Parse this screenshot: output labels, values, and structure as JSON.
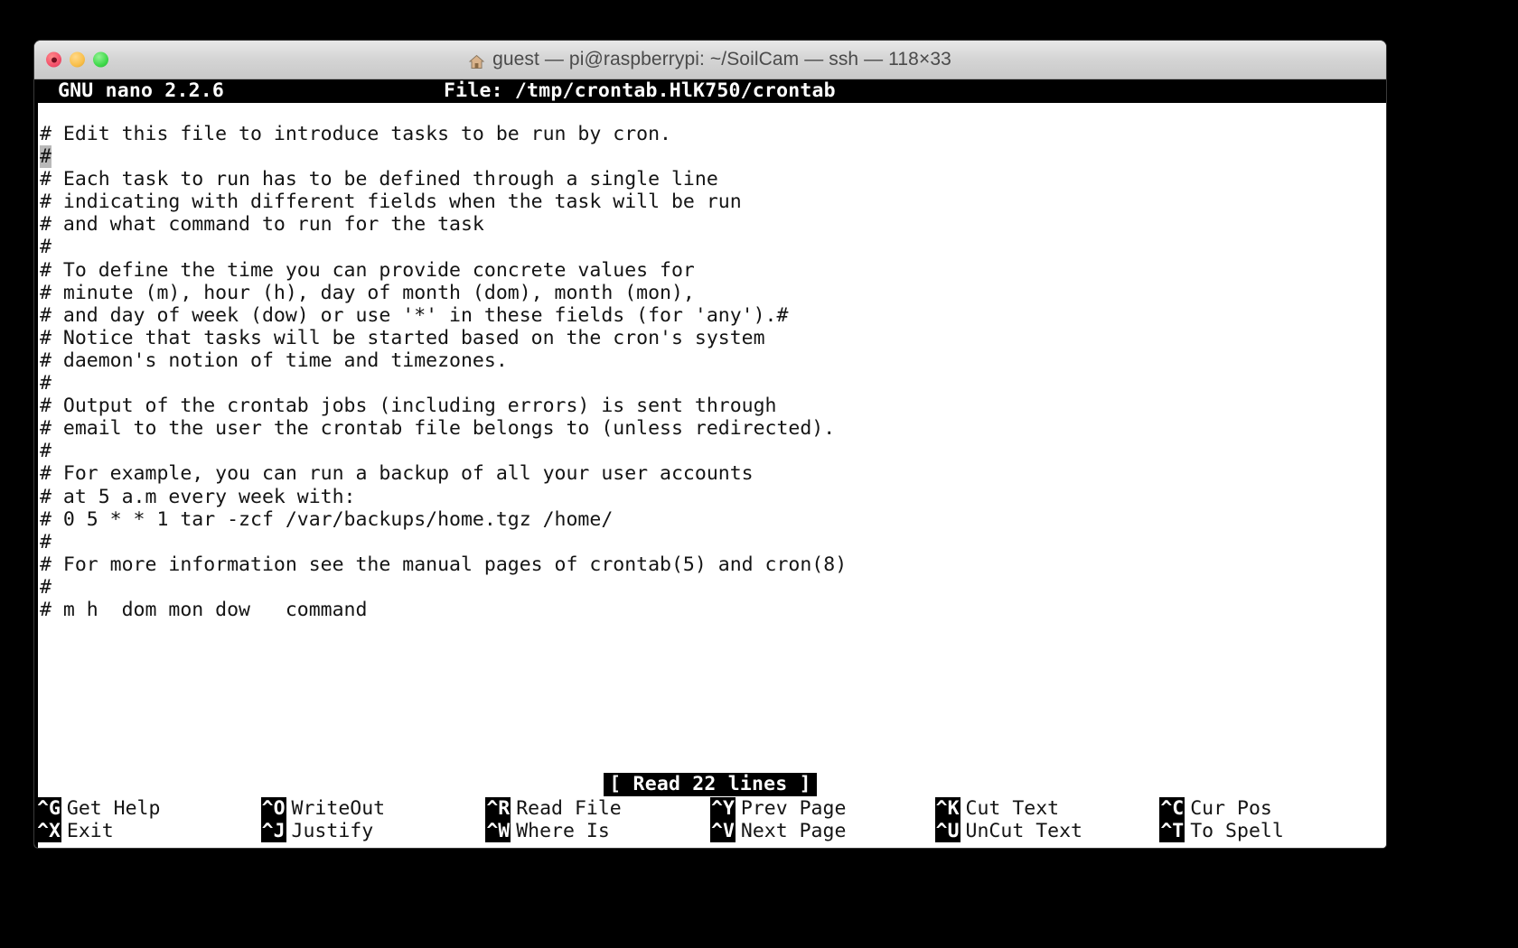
{
  "window": {
    "title": "guest — pi@raspberrypi: ~/SoilCam — ssh — 118×33",
    "home_icon": "home-icon",
    "buttons": {
      "close": "close-button",
      "minimize": "minimize-button",
      "maximize": "maximize-button"
    }
  },
  "nano": {
    "version_label": "GNU nano 2.2.6",
    "file_label": "File: /tmp/crontab.HlK750/crontab",
    "status_message": "[ Read 22 lines ]",
    "cursor": {
      "line": 2,
      "column": 1,
      "char": "#"
    },
    "lines": [
      "# Edit this file to introduce tasks to be run by cron.",
      "#",
      "# Each task to run has to be defined through a single line",
      "# indicating with different fields when the task will be run",
      "# and what command to run for the task",
      "#",
      "# To define the time you can provide concrete values for",
      "# minute (m), hour (h), day of month (dom), month (mon),",
      "# and day of week (dow) or use '*' in these fields (for 'any').#",
      "# Notice that tasks will be started based on the cron's system",
      "# daemon's notion of time and timezones.",
      "#",
      "# Output of the crontab jobs (including errors) is sent through",
      "# email to the user the crontab file belongs to (unless redirected).",
      "#",
      "# For example, you can run a backup of all your user accounts",
      "# at 5 a.m every week with:",
      "# 0 5 * * 1 tar -zcf /var/backups/home.tgz /home/",
      "#",
      "# For more information see the manual pages of crontab(5) and cron(8)",
      "#",
      "# m h  dom mon dow   command"
    ],
    "shortcuts": [
      {
        "key": "^G",
        "label": "Get Help",
        "key2": "^X",
        "label2": "Exit"
      },
      {
        "key": "^O",
        "label": "WriteOut",
        "key2": "^J",
        "label2": "Justify"
      },
      {
        "key": "^R",
        "label": "Read File",
        "key2": "^W",
        "label2": "Where Is"
      },
      {
        "key": "^Y",
        "label": "Prev Page",
        "key2": "^V",
        "label2": "Next Page"
      },
      {
        "key": "^K",
        "label": "Cut Text",
        "key2": "^U",
        "label2": "UnCut Text"
      },
      {
        "key": "^C",
        "label": "Cur Pos",
        "key2": "^T",
        "label2": "To Spell"
      }
    ]
  },
  "colors": {
    "terminal_bg": "#ffffff",
    "terminal_fg": "#141414",
    "inverse_bg": "#000000",
    "inverse_fg": "#ffffff",
    "cursor_bg": "#b9b9b9",
    "desktop_bg": "#000000"
  }
}
